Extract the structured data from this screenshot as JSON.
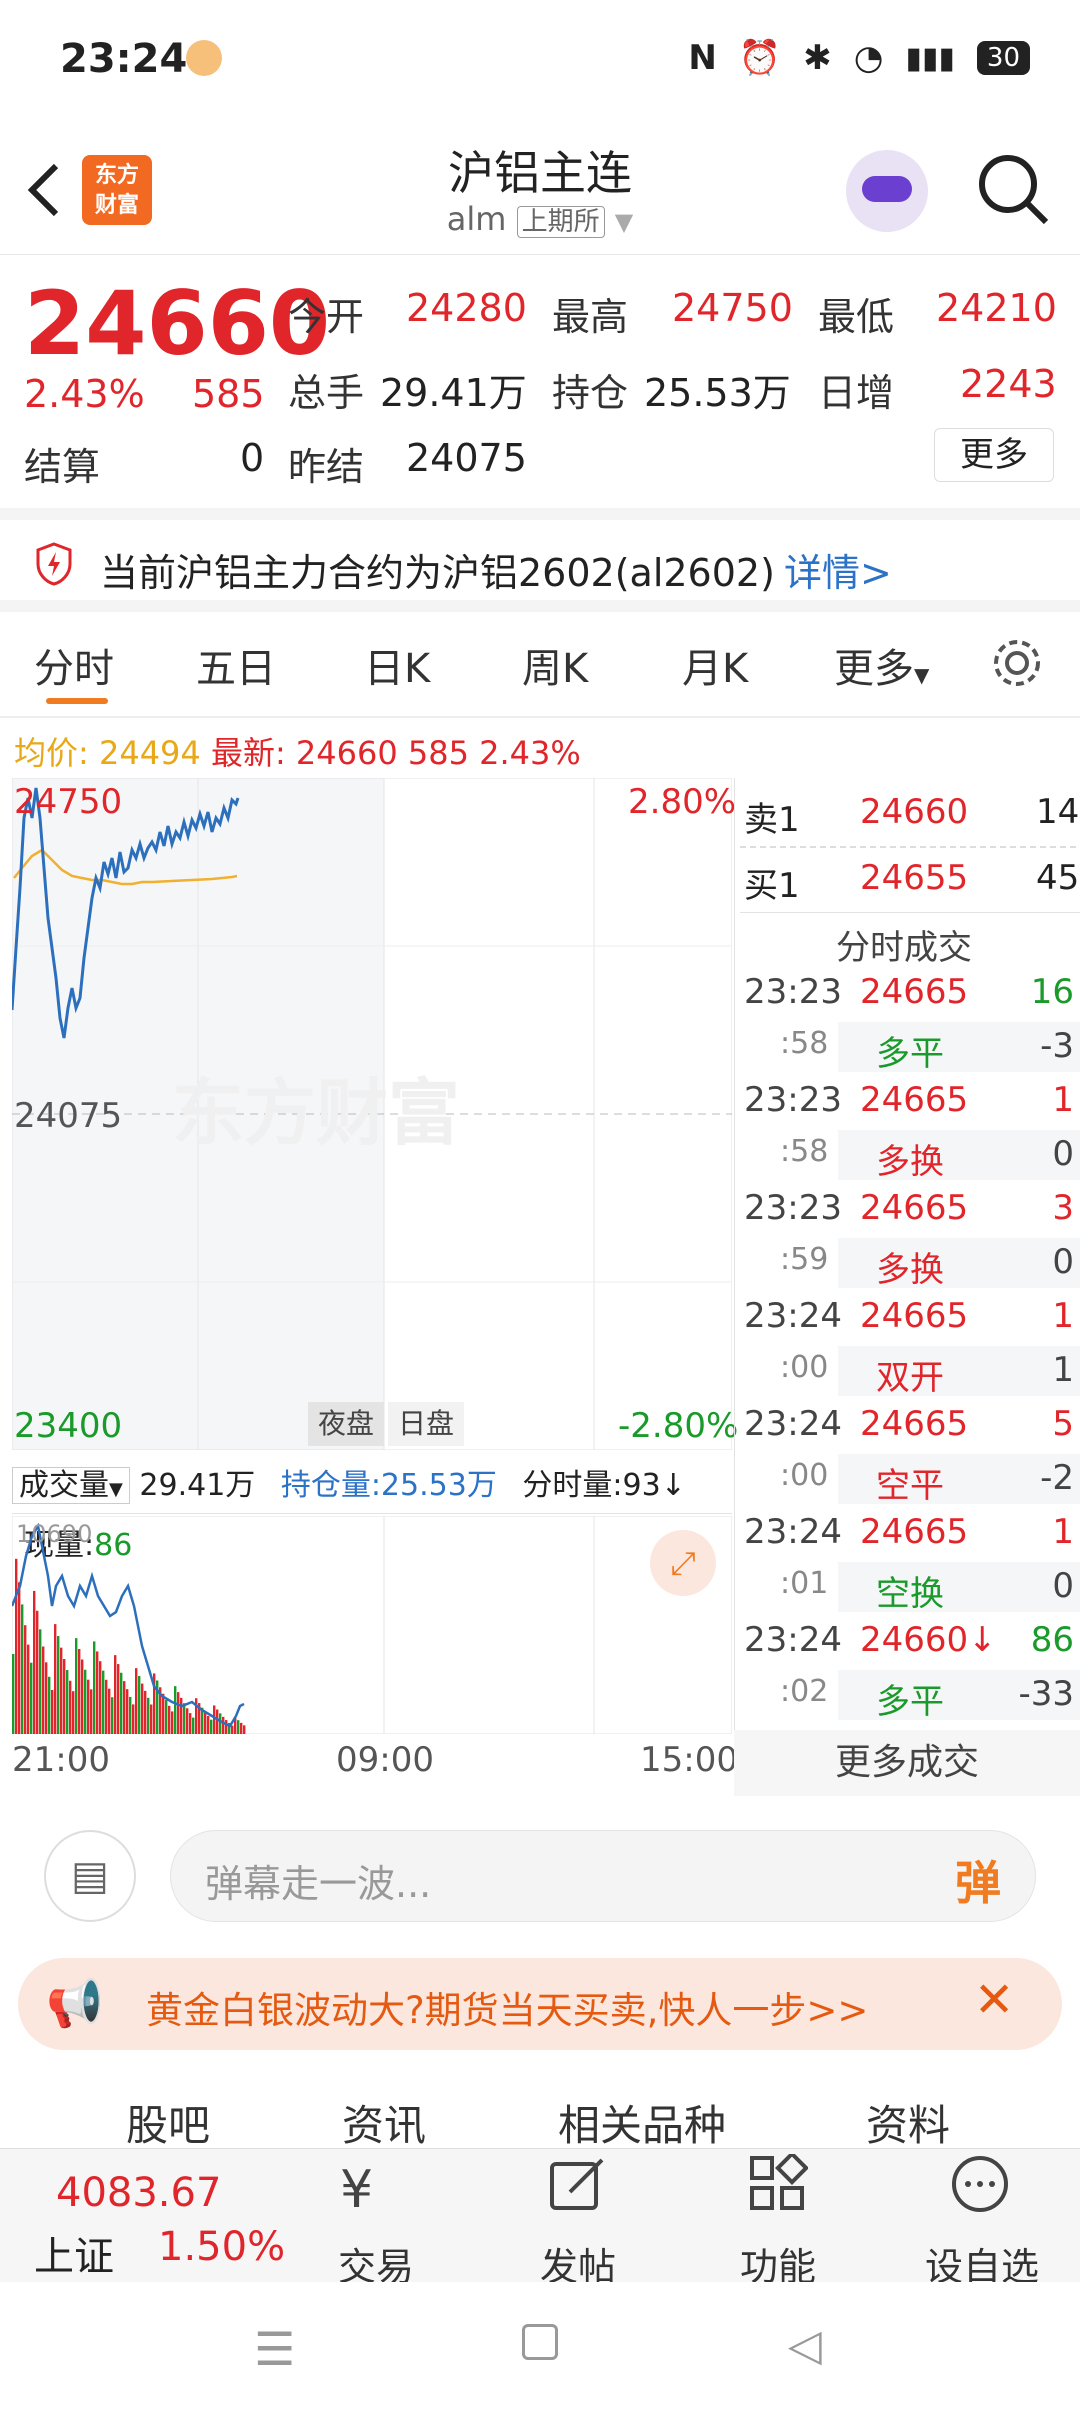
{
  "status": {
    "time": "23:24",
    "battery": "30"
  },
  "header": {
    "logo_line1": "东方",
    "logo_line2": "财富",
    "title": "沪铝主连",
    "code": "alm",
    "exchange": "上期所"
  },
  "quote": {
    "price": "24660",
    "change_pct": "2.43%",
    "change": "585",
    "open_label": "今开",
    "open": "24280",
    "high_label": "最高",
    "high": "24750",
    "low_label": "最低",
    "low": "24210",
    "volume_label": "总手",
    "volume": "29.41万",
    "oi_label": "持仓",
    "oi": "25.53万",
    "daily_inc_label": "日增",
    "daily_inc": "2243",
    "settle_label": "结算",
    "settle": "0",
    "prev_settle_label": "昨结",
    "prev_settle": "24075",
    "more": "更多"
  },
  "notice": {
    "text": "当前沪铝主力合约为沪铝2602(al2602)",
    "link": "详情>"
  },
  "tabs": [
    "分时",
    "五日",
    "日K",
    "周K",
    "月K",
    "更多"
  ],
  "legend": {
    "avg_label": "均价:",
    "avg": "24494",
    "last_label": "最新:",
    "last": "24660",
    "chg": "585",
    "pct": "2.43%"
  },
  "chart": {
    "y_top": "24750",
    "y_mid": "24075",
    "y_bottom": "23400",
    "pct_top": "2.80%",
    "pct_bottom": "-2.80%",
    "night": "夜盘",
    "day": "日盘",
    "watermark": "东方财富",
    "vol_label": "成交量",
    "vol_value": "29.41万",
    "oi_label": "持仓量:25.53万",
    "tick_vol": "分时量:93↓",
    "cur_vol_label": "现量:",
    "cur_vol": "86",
    "vol_max": "10690",
    "x_labels": [
      "21:00",
      "09:00",
      "15:00"
    ]
  },
  "chart_data": {
    "type": "line",
    "ylim": [
      23400,
      24750
    ],
    "series": [],
    "x": []
  },
  "orderbook": {
    "sell_label": "卖1",
    "sell_price": "24660",
    "sell_vol": "14",
    "buy_label": "买1",
    "buy_price": "24655",
    "buy_vol": "45",
    "trades_title": "分时成交",
    "trades": [
      {
        "t": "23:23",
        "p": "24665",
        "v": "16",
        "s": ":58",
        "k": "多平",
        "d": "-3"
      },
      {
        "t": "23:23",
        "p": "24665",
        "v": "1",
        "s": ":58",
        "k": "多换",
        "d": "0"
      },
      {
        "t": "23:23",
        "p": "24665",
        "v": "3",
        "s": ":59",
        "k": "多换",
        "d": "0"
      },
      {
        "t": "23:24",
        "p": "24665",
        "v": "1",
        "s": ":00",
        "k": "双开",
        "d": "1"
      },
      {
        "t": "23:24",
        "p": "24665",
        "v": "5",
        "s": ":00",
        "k": "空平",
        "d": "-2"
      },
      {
        "t": "23:24",
        "p": "24665",
        "v": "1",
        "s": ":01",
        "k": "空换",
        "d": "0"
      },
      {
        "t": "23:24",
        "p": "24660↓",
        "v": "86",
        "s": ":02",
        "k": "多平",
        "d": "-33"
      }
    ],
    "more": "更多成交"
  },
  "comment": {
    "placeholder": "弹幕走一波...",
    "danmu": "弹"
  },
  "promo": {
    "text": "黄金白银波动大?期货当天买卖,快人一步>>"
  },
  "bottom_tabs": [
    "股吧",
    "资讯",
    "相关品种",
    "资料"
  ],
  "index": {
    "value": "4083.67",
    "name": "上证",
    "pct": "1.50%"
  },
  "nav": [
    "交易",
    "发帖",
    "功能",
    "设自选"
  ]
}
